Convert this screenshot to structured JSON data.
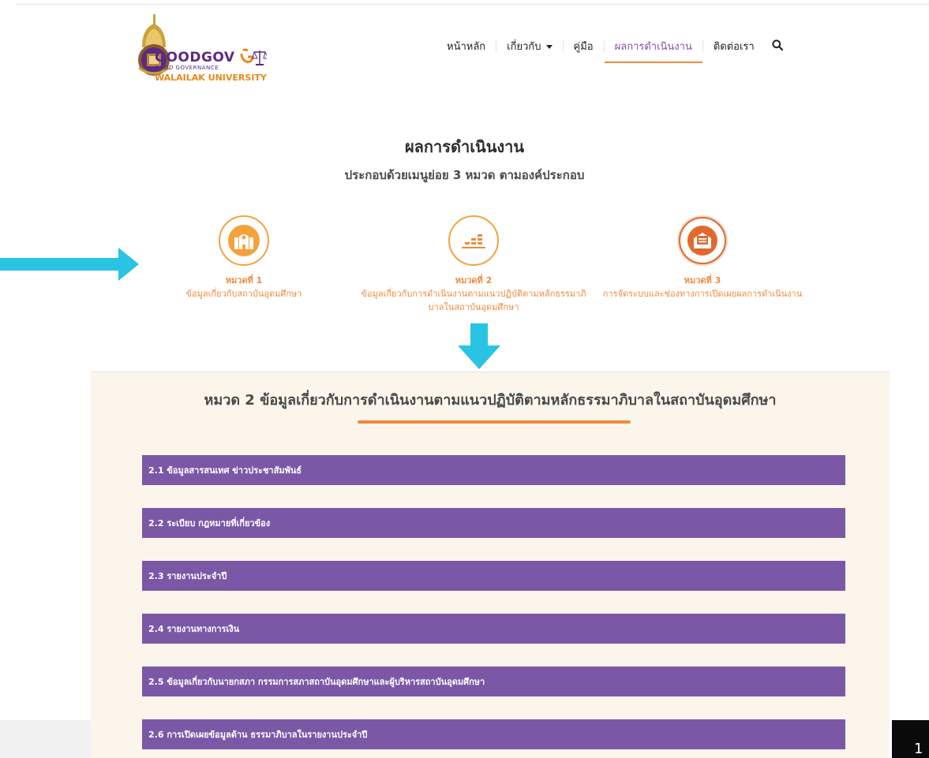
{
  "logo": {
    "brand": "GOODGOV",
    "brand_sub": "GOOD GOVERNANCE",
    "university": "WALAILAK UNIVERSITY"
  },
  "nav": {
    "items": [
      "หน้าหลัก",
      "เกี่ยวกับ",
      "คู่มือ",
      "ผลการดำเนินงาน",
      "ติดต่อเรา"
    ],
    "active": "ผลการดำเนินงาน"
  },
  "heading": {
    "title": "ผลการดำเนินงาน",
    "subtitle": "ประกอบด้วยเมนูย่อย 3 หมวด ตามองค์ประกอบ"
  },
  "categories": [
    {
      "head": "หมวดที่ 1",
      "desc": "ข้อมูลเกี่ยวกับสถาบันอุดมศึกษา"
    },
    {
      "head": "หมวดที่ 2",
      "desc": "ข้อมูลเกี่ยวกับการดำเนินงานตามแนวปฏิบัติตามหลักธรรมาภิบาลในสถาบันอุดมศึกษา"
    },
    {
      "head": "หมวดที่ 3",
      "desc": "การจัดระบบและช่องทางการเปิดเผยผลการดำเนินงาน"
    }
  ],
  "panel": {
    "title": "หมวด 2 ข้อมูลเกี่ยวกับการดำเนินงานตามแนวปฏิบัติตามหลักธรรมาภิบาลในสถาบันอุดมศึกษา",
    "items": [
      "2.1 ข้อมูลสารสนเทศ ข่าวประชาสัมพันธ์",
      "2.2 ระเบียบ กฎหมายที่เกี่ยวข้อง",
      "2.3 รายงานประจำปี",
      "2.4 รายงานทางการเงิน",
      "2.5 ข้อมูลเกี่ยวกับนายกสภา กรรมการสภาสถาบันอุดมศึกษาและผู้บริหารสถาบันอุดมศึกษา",
      "2.6 การเปิดเผยข้อมูลด้าน ธรรมาภิบาลในรายงานประจำปี"
    ]
  },
  "corner": {
    "text": "1"
  },
  "colors": {
    "accent_orange": "#f08a3c",
    "accordion_purple": "#7b58a6",
    "arrow_cyan": "#29c3e4",
    "panel_bg": "#fcf5eb"
  },
  "icons": [
    "search-icon",
    "building-icon",
    "chart-bars-icon",
    "envelope-icon",
    "caret-down-icon",
    "arrow-right-icon",
    "arrow-down-icon"
  ]
}
